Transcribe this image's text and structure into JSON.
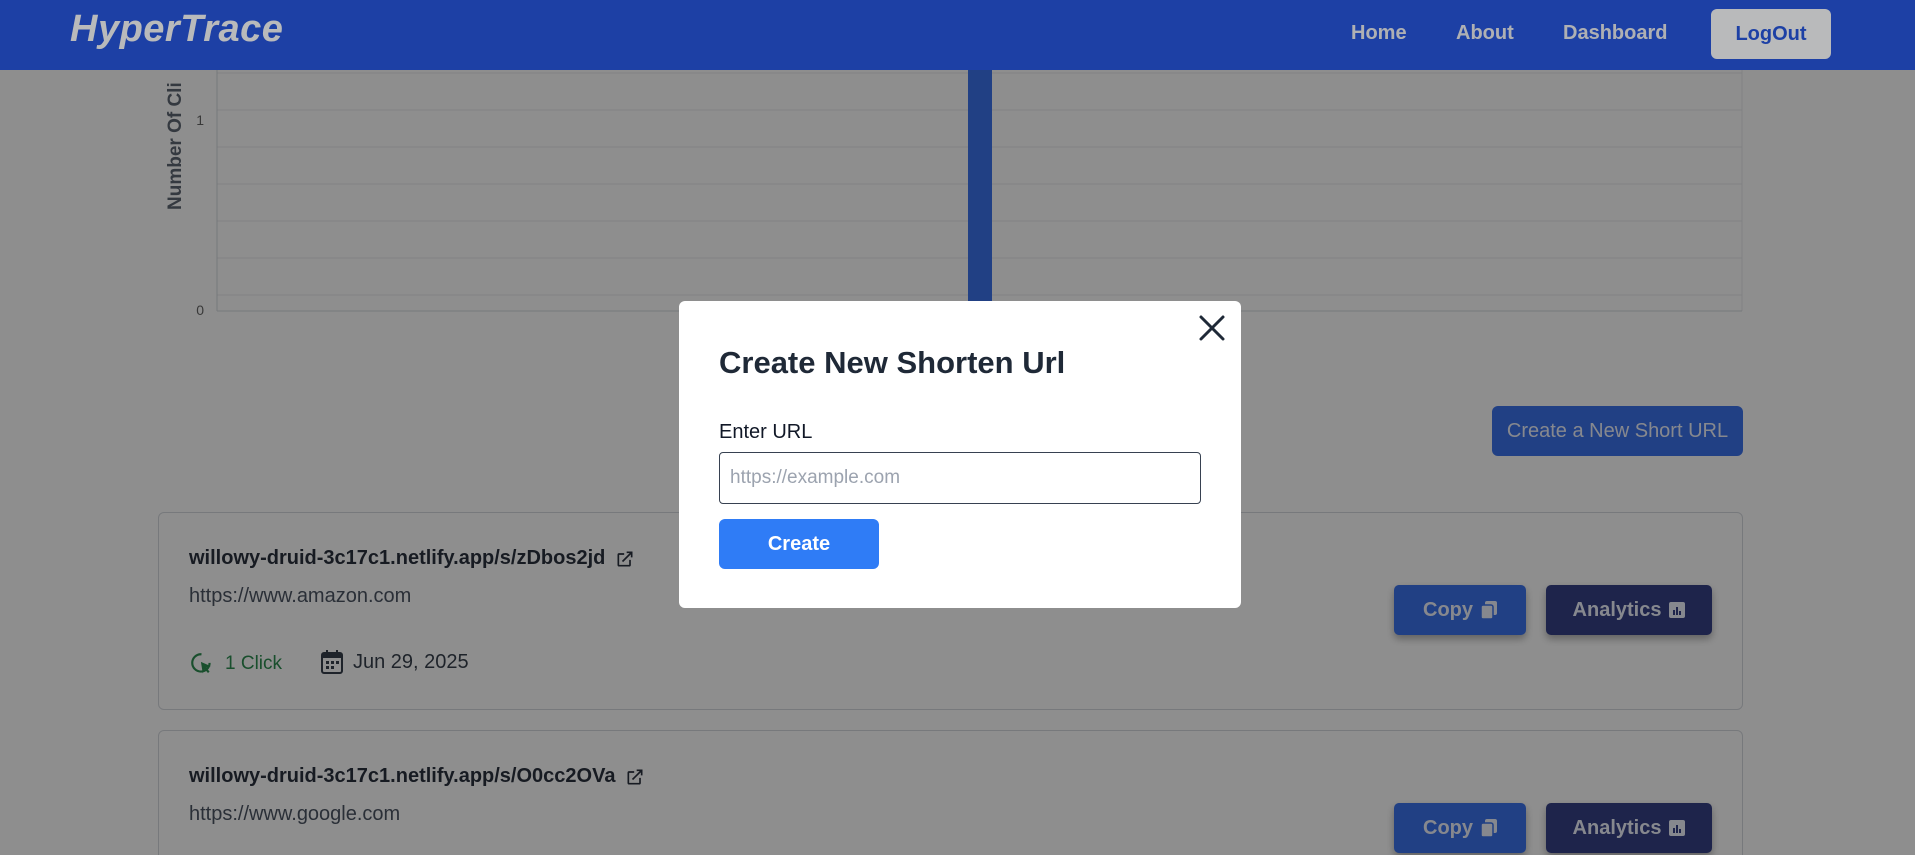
{
  "nav": {
    "logo": "HyperTrace",
    "links": [
      "Home",
      "About",
      "Dashboard"
    ],
    "logout": "LogOut"
  },
  "chart_data": {
    "type": "bar",
    "ylabel": "Number Of Cli",
    "yticks": [
      "0",
      "1"
    ],
    "categories": [
      ""
    ],
    "values": [
      1
    ],
    "colors": {
      "bar": "#2563eb",
      "grid": "#e5e7eb"
    }
  },
  "actions": {
    "create_short_url": "Create a New Short URL"
  },
  "urls": [
    {
      "short": "willowy-druid-3c17c1.netlify.app/s/zDbos2jd",
      "original": "https://www.amazon.com",
      "clicks": "1 Click",
      "date": "Jun 29, 2025",
      "copy": "Copy",
      "analytics": "Analytics"
    },
    {
      "short": "willowy-druid-3c17c1.netlify.app/s/O0cc2OVa",
      "original": "https://www.google.com",
      "copy": "Copy",
      "analytics": "Analytics"
    }
  ],
  "modal": {
    "title": "Create New Shorten Url",
    "label": "Enter URL",
    "placeholder": "https://example.com",
    "value": "",
    "create": "Create"
  }
}
